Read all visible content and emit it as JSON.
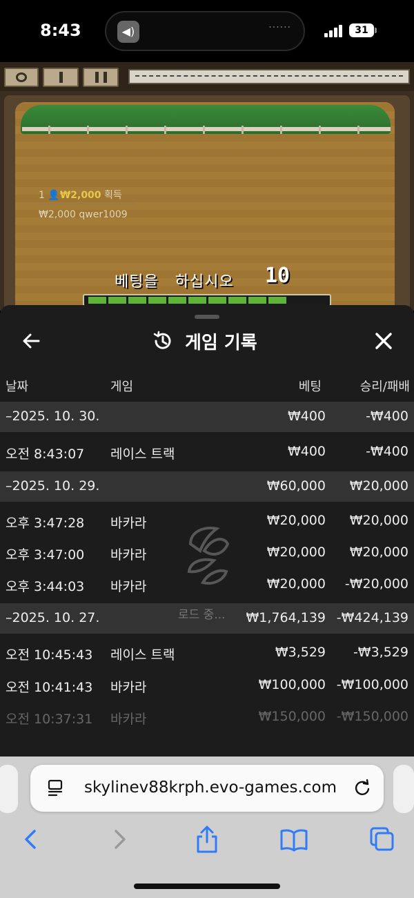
{
  "status": {
    "time": "8:43",
    "battery": "31"
  },
  "game": {
    "winner_rank": "1",
    "winner_amount": "₩2,000",
    "winner_label": "획득",
    "winner_line": "₩2,000 qwer1009",
    "prompt_word1": "베팅을",
    "prompt_word2": "하십시오",
    "countdown": "10"
  },
  "history": {
    "title": "게임 기록",
    "columns": {
      "date": "날짜",
      "game": "게임",
      "bet": "베팅",
      "result": "승리/패배"
    },
    "loading": "로드 중...",
    "groups": [
      {
        "date": "–2025. 10. 30.",
        "bet": "₩400",
        "result": "-₩400",
        "rows": [
          {
            "time": "오전 8:43:07",
            "game": "레이스 트랙",
            "bet": "₩400",
            "result": "-₩400"
          }
        ]
      },
      {
        "date": "–2025. 10. 29.",
        "bet": "₩60,000",
        "result": "₩20,000",
        "rows": [
          {
            "time": "오후 3:47:28",
            "game": "바카라",
            "bet": "₩20,000",
            "result": "₩20,000"
          },
          {
            "time": "오후 3:47:00",
            "game": "바카라",
            "bet": "₩20,000",
            "result": "₩20,000"
          },
          {
            "time": "오후 3:44:03",
            "game": "바카라",
            "bet": "₩20,000",
            "result": "-₩20,000"
          }
        ]
      },
      {
        "date": "–2025. 10. 27.",
        "bet": "₩1,764,139",
        "result": "-₩424,139",
        "rows": [
          {
            "time": "오전 10:45:43",
            "game": "레이스 트랙",
            "bet": "₩3,529",
            "result": "-₩3,529"
          },
          {
            "time": "오전 10:41:43",
            "game": "바카라",
            "bet": "₩100,000",
            "result": "-₩100,000"
          },
          {
            "time": "오전 10:37:31",
            "game": "바카라",
            "bet": "₩150,000",
            "result": "-₩150,000"
          }
        ]
      }
    ]
  },
  "browser": {
    "url": "skylinev88krph.evo-games.com"
  }
}
